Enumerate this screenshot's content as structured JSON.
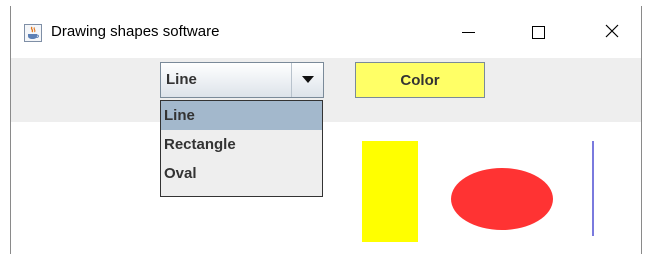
{
  "window": {
    "title": "Drawing shapes software"
  },
  "toolbar": {
    "shape_select": {
      "value": "Line",
      "options": [
        "Line",
        "Rectangle",
        "Oval"
      ],
      "highlighted": "Line"
    },
    "color_button_label": "Color"
  },
  "canvas": {
    "shapes": [
      "rectangle",
      "oval",
      "line"
    ],
    "colors": {
      "rectangle": "#ffff00",
      "oval": "#ff3333",
      "line": "#3333cc",
      "color_button": "#ffff66"
    }
  },
  "icons": {
    "app": "java-coffee-icon",
    "minimize": "minimize-icon",
    "maximize": "maximize-icon",
    "close": "close-icon",
    "dropdown": "chevron-down-icon"
  }
}
